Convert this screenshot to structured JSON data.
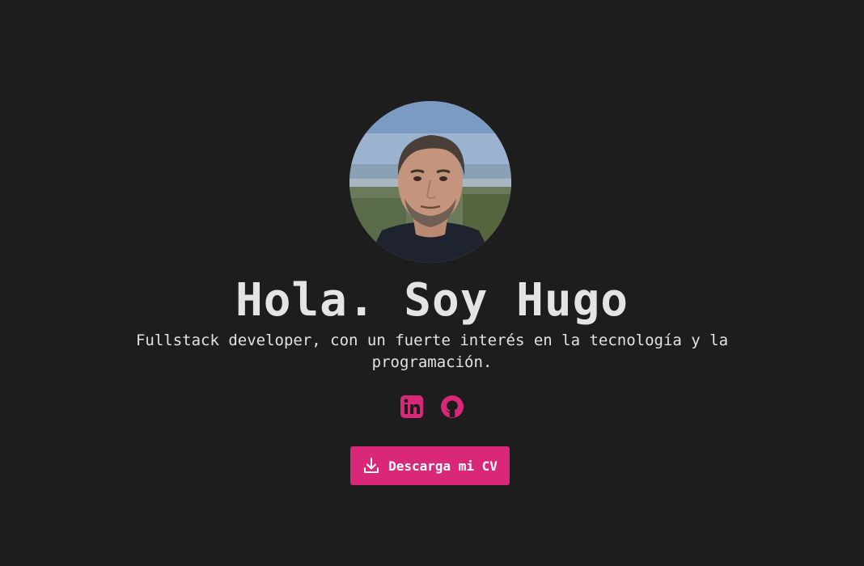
{
  "hero": {
    "title": "Hola. Soy Hugo",
    "subtitle": "Fullstack developer, con un fuerte interés en la tecnología y la programación."
  },
  "socials": [
    {
      "icon": "linkedin-icon"
    },
    {
      "icon": "github-icon"
    }
  ],
  "cv_button": {
    "label": "Descarga mi CV",
    "icon": "download-icon"
  },
  "colors": {
    "background": "#1e1d1e",
    "accent": "#d92878",
    "text": "#e4e4e4"
  }
}
